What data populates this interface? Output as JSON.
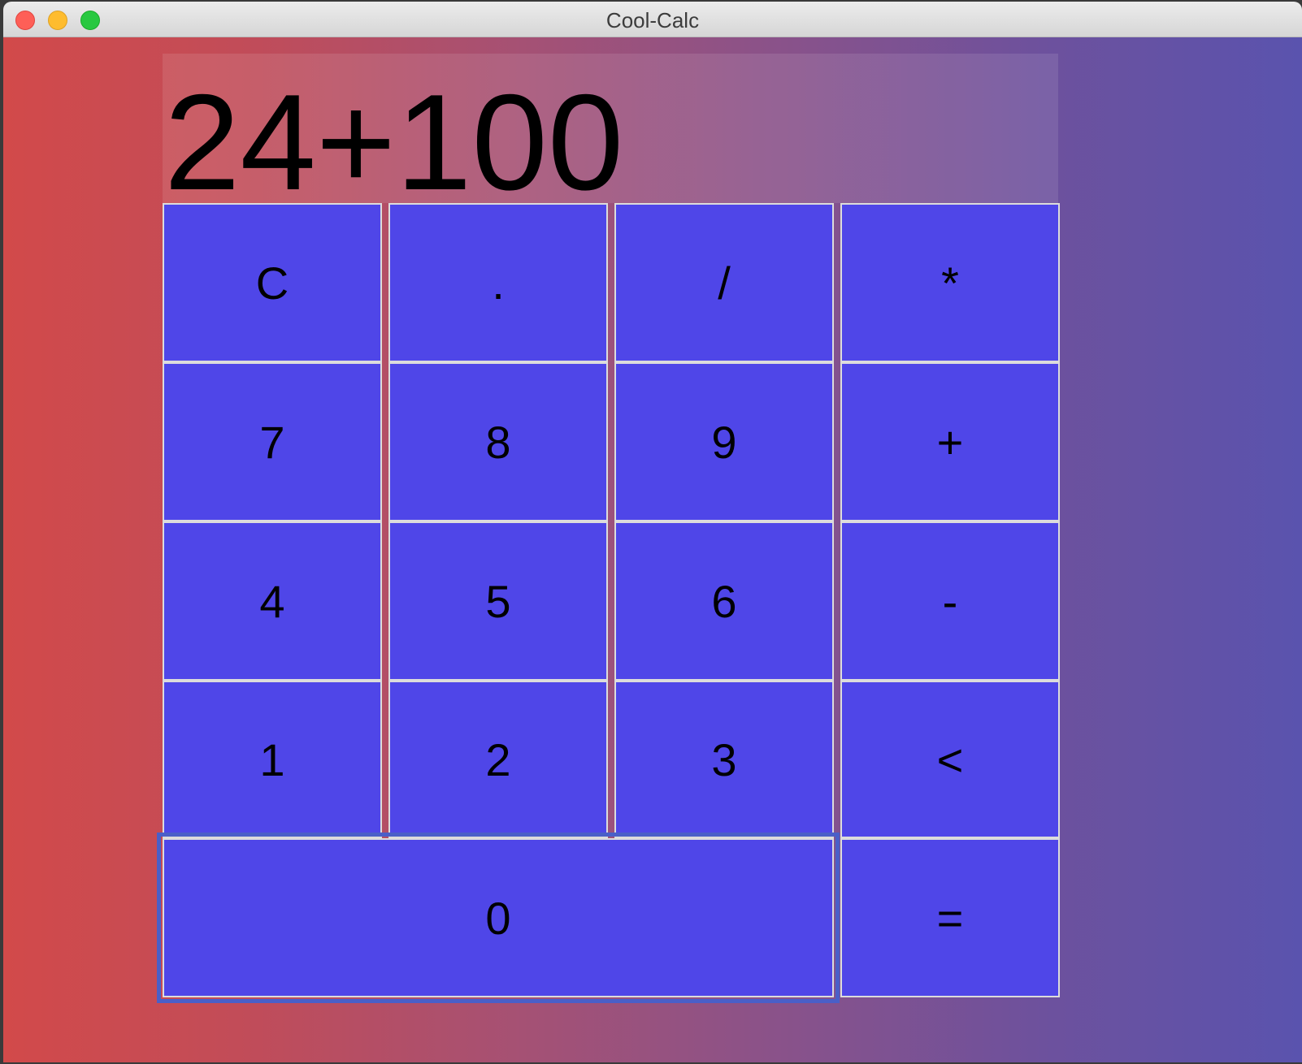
{
  "window": {
    "title": "Cool-Calc"
  },
  "display": {
    "expression": "24+100"
  },
  "keys": {
    "clear": "C",
    "decimal": ".",
    "divide": "/",
    "multiply": "*",
    "seven": "7",
    "eight": "8",
    "nine": "9",
    "plus": "+",
    "four": "4",
    "five": "5",
    "six": "6",
    "minus": "-",
    "one": "1",
    "two": "2",
    "three": "3",
    "backspace": "<",
    "zero": "0",
    "equals": "="
  },
  "colors": {
    "key_background": "#4f46e8",
    "gradient_left": "#d24a4a",
    "gradient_right": "#5a53ae"
  }
}
